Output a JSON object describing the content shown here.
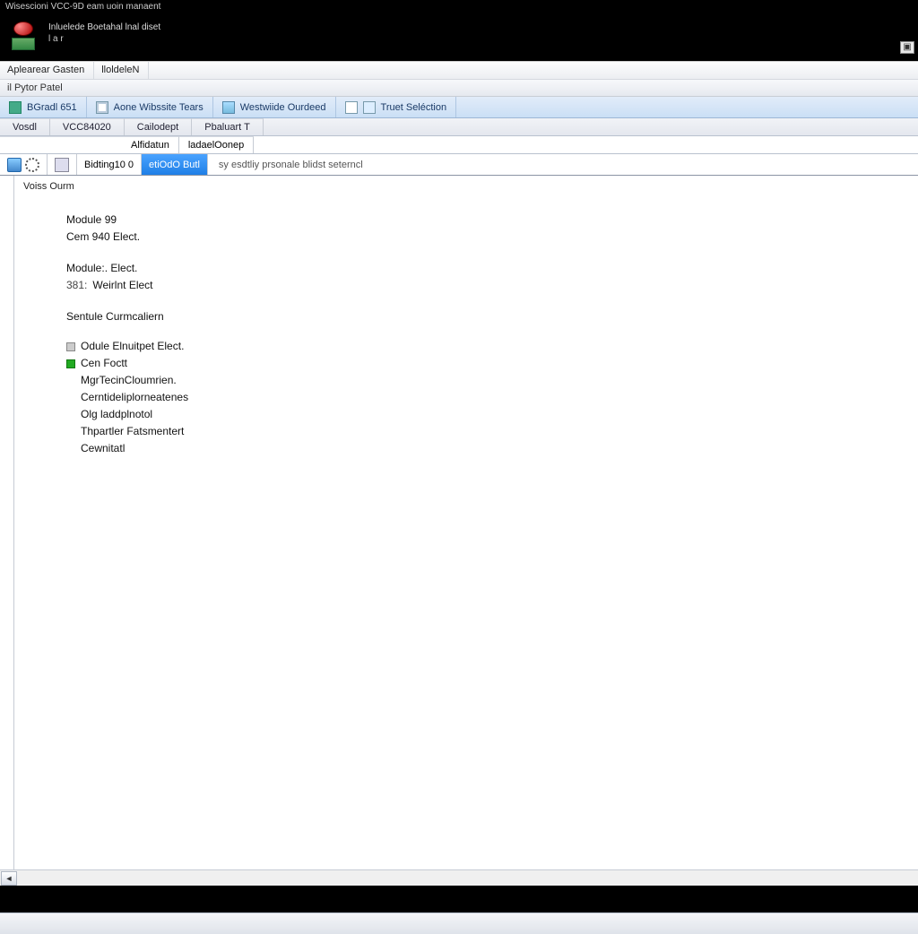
{
  "title": "Wisescioni   VCC-9D eam uoin manaent",
  "header": {
    "line1": "Inluelede Boetahal lnal diset",
    "line2": "l a r"
  },
  "menubar": {
    "items": [
      "Aplearear Gasten",
      "lloldeleN"
    ]
  },
  "subbar": "il Pytor Patel",
  "toolbar": {
    "items": [
      {
        "icon": "green",
        "label": "BGradl 651"
      },
      {
        "icon": "doc",
        "label": "Aone Wibssite Tears"
      },
      {
        "icon": "grid",
        "label": "Westwiide Ourdeed"
      },
      {
        "icon": "win",
        "label": "Truet Seléction"
      }
    ]
  },
  "tabs": [
    "Vosdl",
    "VCC84020",
    "Cailodept",
    "Pbaluart   T"
  ],
  "subtabs": [
    "Alfidatun",
    "ladaelOonep"
  ],
  "iconrow": {
    "seg1_label": "Bidting10 0",
    "seg_sel_label": "etiOdO Butl",
    "desc": "sy esdtliy prsonale blidst seterncl"
  },
  "pane": {
    "heading": "Voiss Ourm",
    "group1": {
      "l1": "Module 99",
      "l2": "Cem  940 Elect."
    },
    "group2": {
      "l1": "Module:. Elect.",
      "l2": "Weirlnt Elect",
      "prefix": "381:"
    },
    "group3": {
      "title": "Sentule Curmcaliern",
      "items": [
        {
          "sq": "gray",
          "text": "Odule Elnuitpet Elect."
        },
        {
          "sq": "green",
          "text": "Cen Foctt"
        }
      ],
      "subitems": [
        "MgrTecinCloumrien.",
        "Cerntideliplorneatenes",
        "Olg laddplnotol",
        "Thpartler Fatsmentert",
        "Cewnitatl"
      ]
    }
  }
}
